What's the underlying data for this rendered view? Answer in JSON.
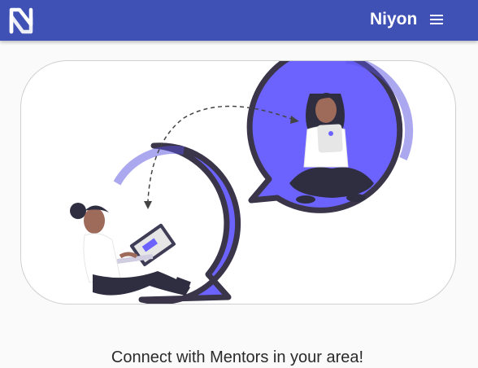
{
  "header": {
    "brand": "Niyon",
    "logo_icon": "niyon-logo-icon",
    "menu_icon": "hamburger-menu-icon",
    "background_color": "#3f51b5"
  },
  "hero": {
    "illustration": "mentor-connection-illustration",
    "accent_color": "#6c63ff",
    "tagline": "Connect with Mentors in your area!"
  }
}
